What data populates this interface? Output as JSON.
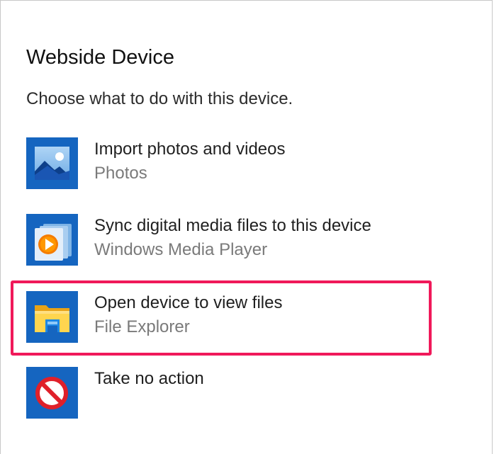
{
  "dialog": {
    "title": "Webside Device",
    "subtitle": "Choose what to do with this device."
  },
  "options": [
    {
      "primary": "Import photos and videos",
      "secondary": "Photos",
      "icon": "photos-icon"
    },
    {
      "primary": "Sync digital media files to this device",
      "secondary": "Windows Media Player",
      "icon": "windows-media-player-icon"
    },
    {
      "primary": "Open device to view files",
      "secondary": "File Explorer",
      "icon": "file-explorer-icon",
      "highlighted": true
    },
    {
      "primary": "Take no action",
      "secondary": "",
      "icon": "no-action-icon"
    }
  ],
  "colors": {
    "tile_blue": "#1565c0",
    "highlight": "#f0195a",
    "secondary_text": "#7a7a7a"
  }
}
